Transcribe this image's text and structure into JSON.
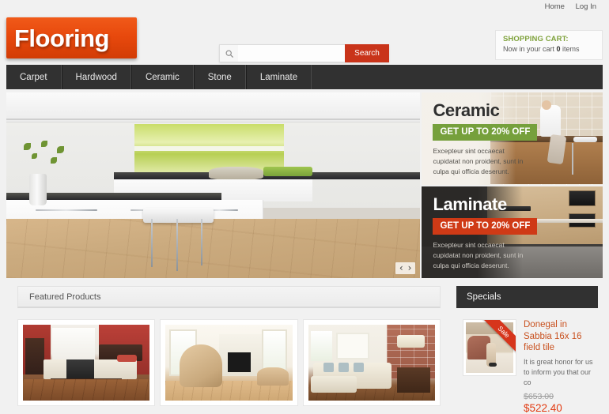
{
  "topbar": {
    "links": [
      {
        "label": "Home"
      },
      {
        "label": "Log In"
      }
    ]
  },
  "header": {
    "logo": "Flooring",
    "search": {
      "icon": "search-icon",
      "value": "",
      "placeholder": "",
      "button_label": "Search"
    },
    "cart": {
      "title": "SHOPPING CART:",
      "prefix": "Now in your cart ",
      "count": "0",
      "suffix": " items"
    }
  },
  "nav": {
    "items": [
      {
        "label": "Carpet"
      },
      {
        "label": "Hardwood"
      },
      {
        "label": "Ceramic"
      },
      {
        "label": "Stone"
      },
      {
        "label": "Laminate"
      }
    ]
  },
  "hero": {
    "alt": "modern white kitchen with green backlit shelves and light oak hardwood floor",
    "prev": "‹",
    "next": "›"
  },
  "promos": [
    {
      "title": "Ceramic",
      "badge": "GET UP TO 20% OFF",
      "badge_color": "#76a03c",
      "desc": "Excepteur sint occaecat cupidatat non proident, sunt in culpa qui officia deserunt."
    },
    {
      "title": "Laminate",
      "badge": "GET UP TO 20% OFF",
      "badge_color": "#cf3a16",
      "desc": "Excepteur sint occaecat cupidatat non proident, sunt in culpa qui officia deserunt."
    }
  ],
  "featured": {
    "title": "Featured Products",
    "products": [
      {
        "alt": "bedroom with red walls, dark wood bed and hardwood floor"
      },
      {
        "alt": "tan leather armchair beside fireplace on light wood floor"
      },
      {
        "alt": "cream sectional sofa in living room with brick wall"
      }
    ]
  },
  "specials": {
    "title": "Specials",
    "item": {
      "ribbon": "Sale",
      "name": "Donegal in Sabbia 16x 16 field tile",
      "desc": "It is great honor for us to inform you that our co",
      "price_old": "$653.00",
      "price_new": "$522.40"
    }
  },
  "colors": {
    "brand_orange": "#e8490d",
    "nav_dark": "#313131",
    "accent_green": "#76a03c",
    "accent_red": "#cf3a16",
    "sale_price": "#e23b12",
    "page_bg": "#f1f1f1"
  }
}
